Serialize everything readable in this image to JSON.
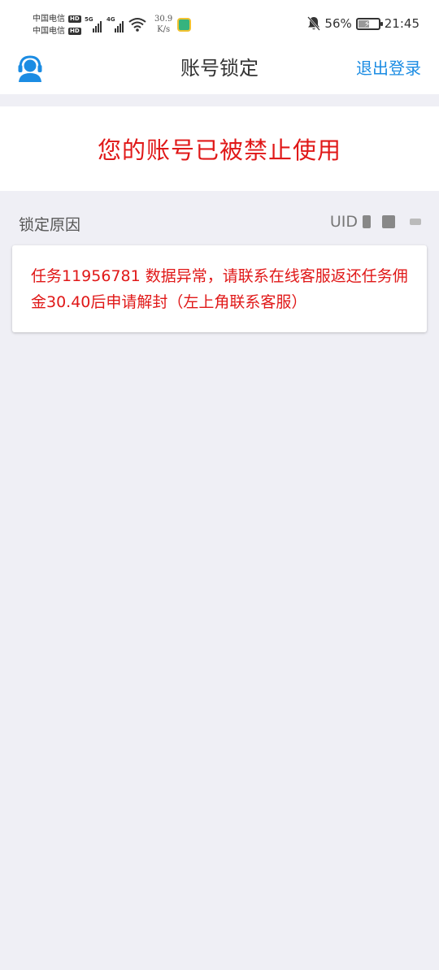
{
  "status_bar": {
    "carrier_1": "中国电信",
    "carrier_2": "中国电信",
    "hd_badge": "HD",
    "signal_1_tag": "5G",
    "signal_2_tag": "4G",
    "speed_value": "30.9",
    "speed_unit": "K/s",
    "battery_percent": "56%",
    "battery_level": 0.56,
    "time": "21:45"
  },
  "app_bar": {
    "title": "账号锁定",
    "logout_label": "退出登录",
    "support_icon": "customer-service-icon",
    "accent_color": "#1b8ce3"
  },
  "banner": {
    "message": "您的账号已被禁止使用",
    "color": "#e01818"
  },
  "reason": {
    "label": "锁定原因",
    "uid_label": "UID",
    "text": "任务11956781 数据异常，请联系在线客服返还任务佣金30.40后申请解封（左上角联系客服）"
  }
}
